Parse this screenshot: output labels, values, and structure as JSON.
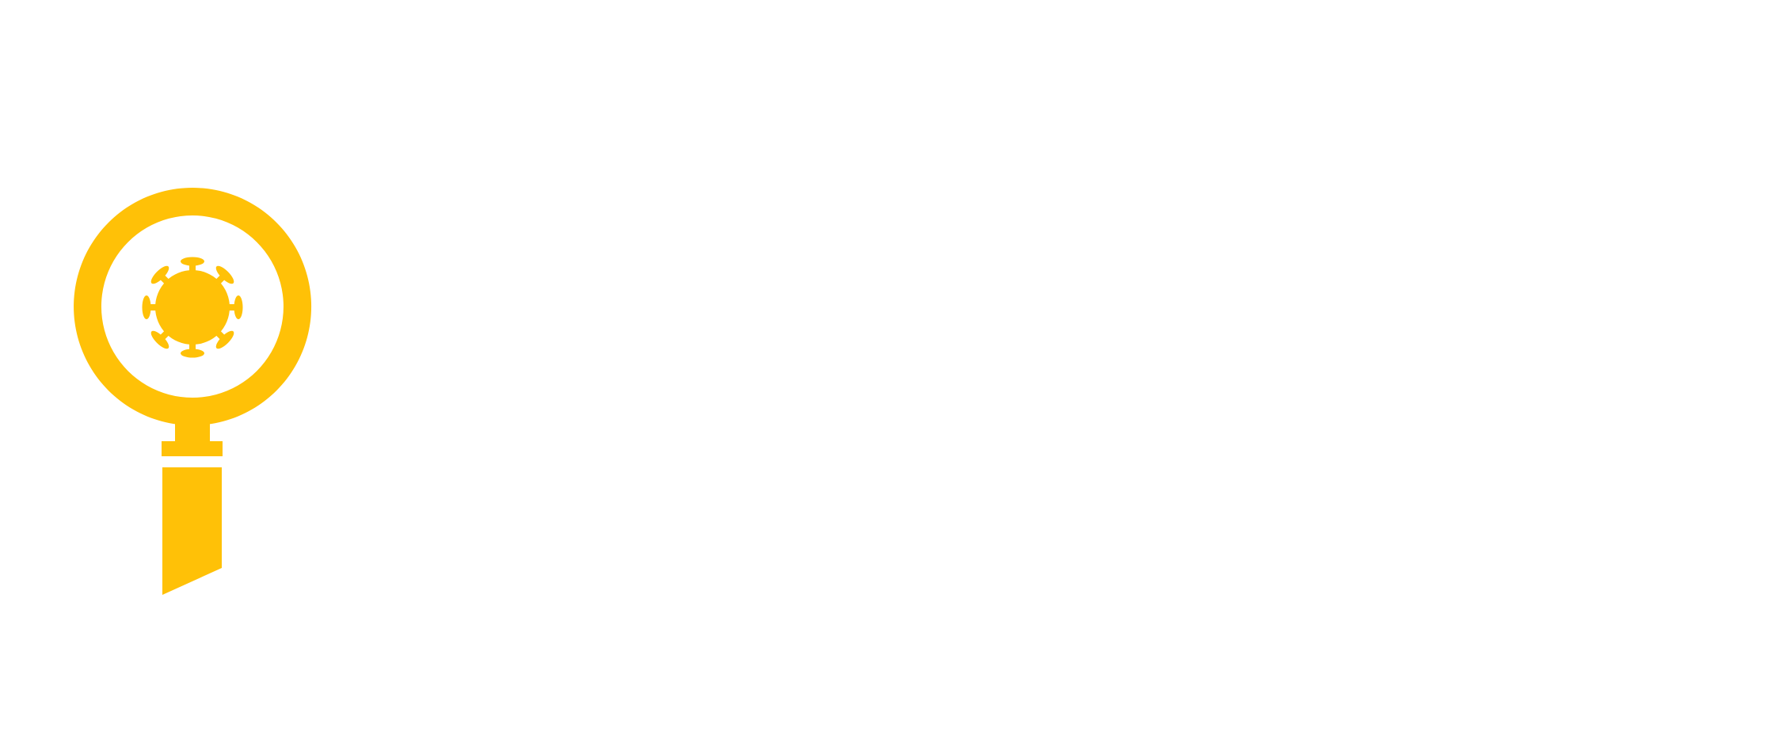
{
  "logo": {
    "icon": "magnifier-virus-icon",
    "brand_color": "#FFC107",
    "background_color": "#FFFFFF"
  }
}
